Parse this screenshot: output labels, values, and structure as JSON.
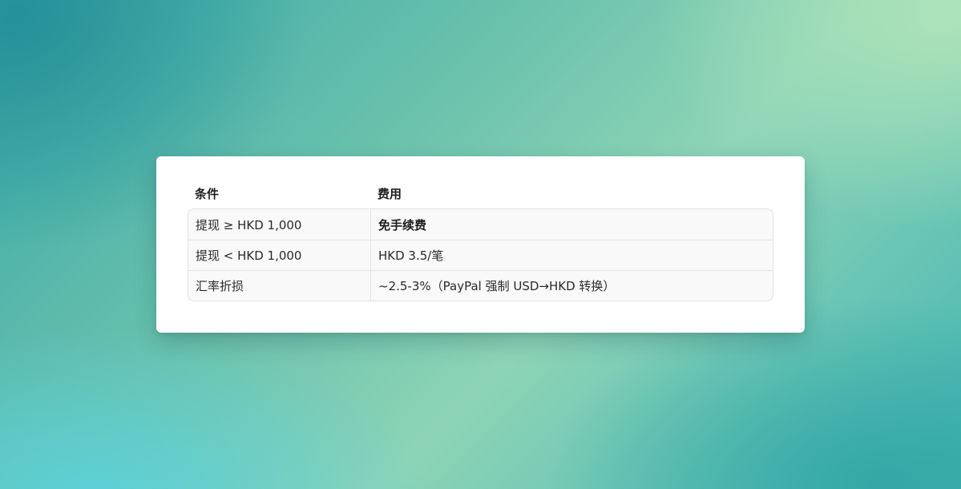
{
  "table": {
    "headers": [
      "条件",
      "费用"
    ],
    "rows": [
      {
        "condition": "提现 ≥ HKD 1,000",
        "fee": "免手续费",
        "fee_bold": true
      },
      {
        "condition": "提现 < HKD 1,000",
        "fee": "HKD 3.5/笔",
        "fee_bold": false
      },
      {
        "condition": "汇率折损",
        "fee": "~2.5-3%（PayPal 强制 USD→HKD 转换）",
        "fee_bold": false
      }
    ]
  }
}
